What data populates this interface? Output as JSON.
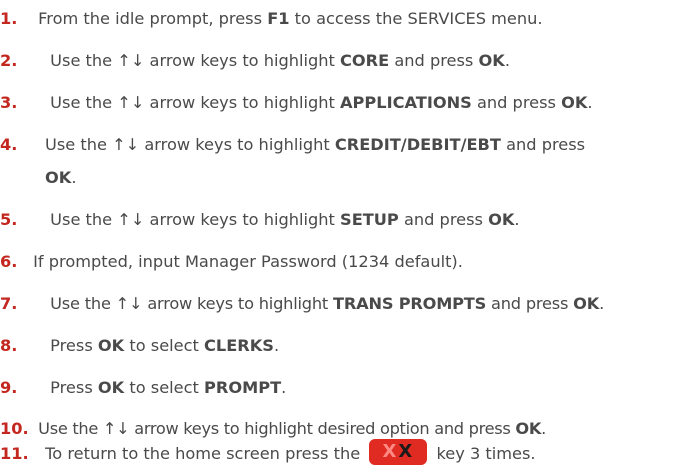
{
  "steps": [
    {
      "num": "1.",
      "parts": [
        {
          "t": "From the idle prompt, press "
        },
        {
          "b": "F1"
        },
        {
          "t": " to access the SERVICES menu."
        }
      ]
    },
    {
      "num": "2.",
      "parts": [
        {
          "t": "Use the ↑↓ arrow keys to highlight "
        },
        {
          "b": "CORE"
        },
        {
          "t": " and press "
        },
        {
          "b": "OK"
        },
        {
          "t": "."
        }
      ]
    },
    {
      "num": "3.",
      "parts": [
        {
          "t": "Use the ↑↓ arrow keys to highlight "
        },
        {
          "b": "APPLICATIONS"
        },
        {
          "t": " and press "
        },
        {
          "b": "OK"
        },
        {
          "t": "."
        }
      ]
    },
    {
      "num": "4.",
      "parts": [
        {
          "t": "Use the ↑↓ arrow keys to highlight "
        },
        {
          "b": "CREDIT/DEBIT/EBT"
        },
        {
          "t": " and press"
        }
      ],
      "cont": [
        {
          "b": "OK"
        },
        {
          "t": "."
        }
      ]
    },
    {
      "num": "5.",
      "parts": [
        {
          "t": "Use the ↑↓ arrow keys to highlight "
        },
        {
          "b": "SETUP"
        },
        {
          "t": " and press "
        },
        {
          "b": "OK"
        },
        {
          "t": "."
        }
      ]
    },
    {
      "num": "6.",
      "parts": [
        {
          "t": "If prompted, input Manager Password (1234 default)."
        }
      ]
    },
    {
      "num": "7.",
      "parts": [
        {
          "t": "Use the ↑↓ arrow keys to highlight "
        },
        {
          "b": "TRANS PROMPTS"
        },
        {
          "t": " and press "
        },
        {
          "b": "OK"
        },
        {
          "t": "."
        }
      ]
    },
    {
      "num": "8.",
      "parts": [
        {
          "t": "Press "
        },
        {
          "b": "OK"
        },
        {
          "t": " to select "
        },
        {
          "b": "CLERKS"
        },
        {
          "t": "."
        }
      ]
    },
    {
      "num": "9.",
      "parts": [
        {
          "t": "Press "
        },
        {
          "b": "OK"
        },
        {
          "t": " to select "
        },
        {
          "b": "PROMPT"
        },
        {
          "t": "."
        }
      ]
    },
    {
      "num": "10.",
      "parts": [
        {
          "t": "Use the ↑↓ arrow keys to highlight desired option and press "
        },
        {
          "b": "OK"
        },
        {
          "t": "."
        }
      ]
    },
    {
      "num": "11.",
      "parts": [
        {
          "t": "To return to the home screen press the "
        },
        {
          "key": "x-key"
        },
        {
          "t": " key 3 times."
        }
      ]
    }
  ],
  "xkey": {
    "label_light": "X",
    "label_dark": "X",
    "color": "#e02b22"
  },
  "colors": {
    "number": "#c3271f",
    "text": "#4a4a4a"
  }
}
